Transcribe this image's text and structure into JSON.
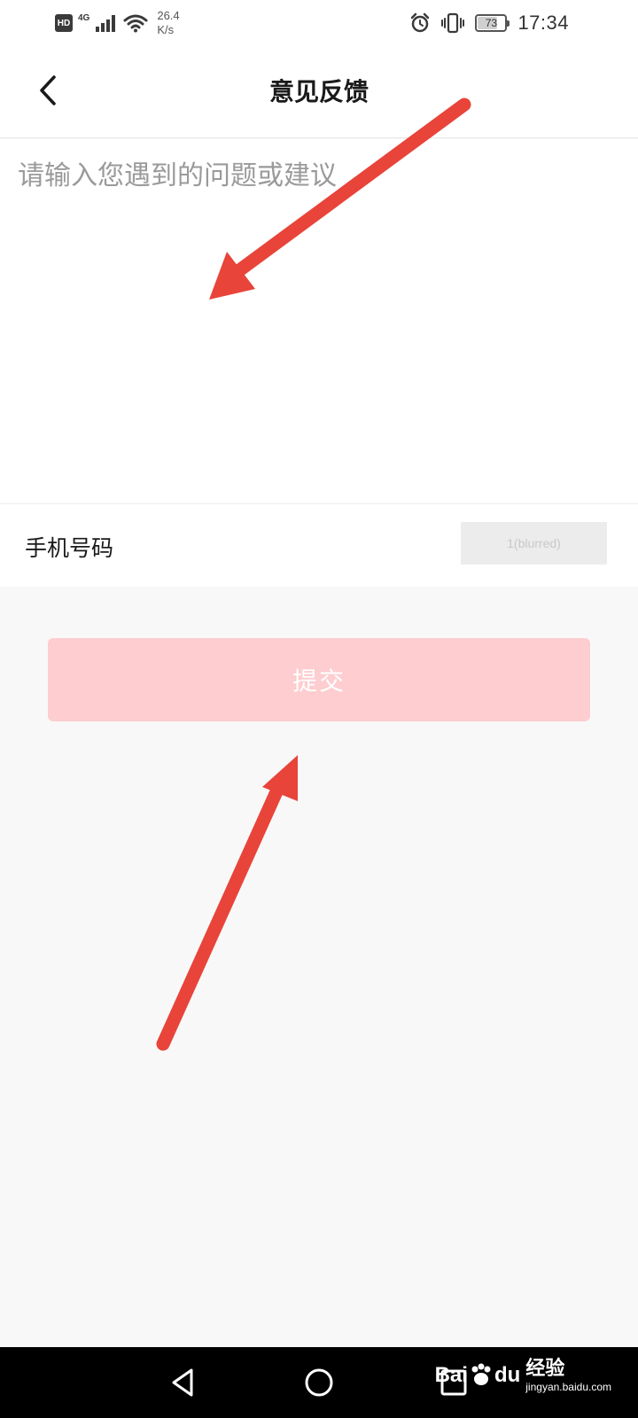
{
  "status_bar": {
    "hd_badge": "HD",
    "network_type": "4G",
    "net_speed_value": "26.4",
    "net_speed_unit": "K/s",
    "battery_level": "73",
    "battery_fraction": 0.73,
    "time": "17:34",
    "icons": [
      "signal-icon",
      "wifi-icon",
      "alarm-icon",
      "vibrate-icon",
      "battery-icon"
    ]
  },
  "header": {
    "title": "意见反馈",
    "back_icon": "chevron-left-icon"
  },
  "feedback": {
    "placeholder": "请输入您遇到的问题或建议",
    "value": ""
  },
  "phone": {
    "label": "手机号码",
    "value": "1(blurred)"
  },
  "submit": {
    "label": "提交"
  },
  "annotations": {
    "arrow_color": "#e8443a"
  },
  "colors": {
    "submit_bg": "#fdcdd0",
    "page_bg": "#f8f8f8",
    "nav_bar_bg": "#000000"
  },
  "system_nav": {
    "icons": [
      "back-triangle-icon",
      "home-circle-icon",
      "recent-square-icon"
    ]
  },
  "watermark": {
    "logo_text": "Bai",
    "logo_suffix": "du",
    "title": "经验",
    "url": "jingyan.baidu.com"
  }
}
